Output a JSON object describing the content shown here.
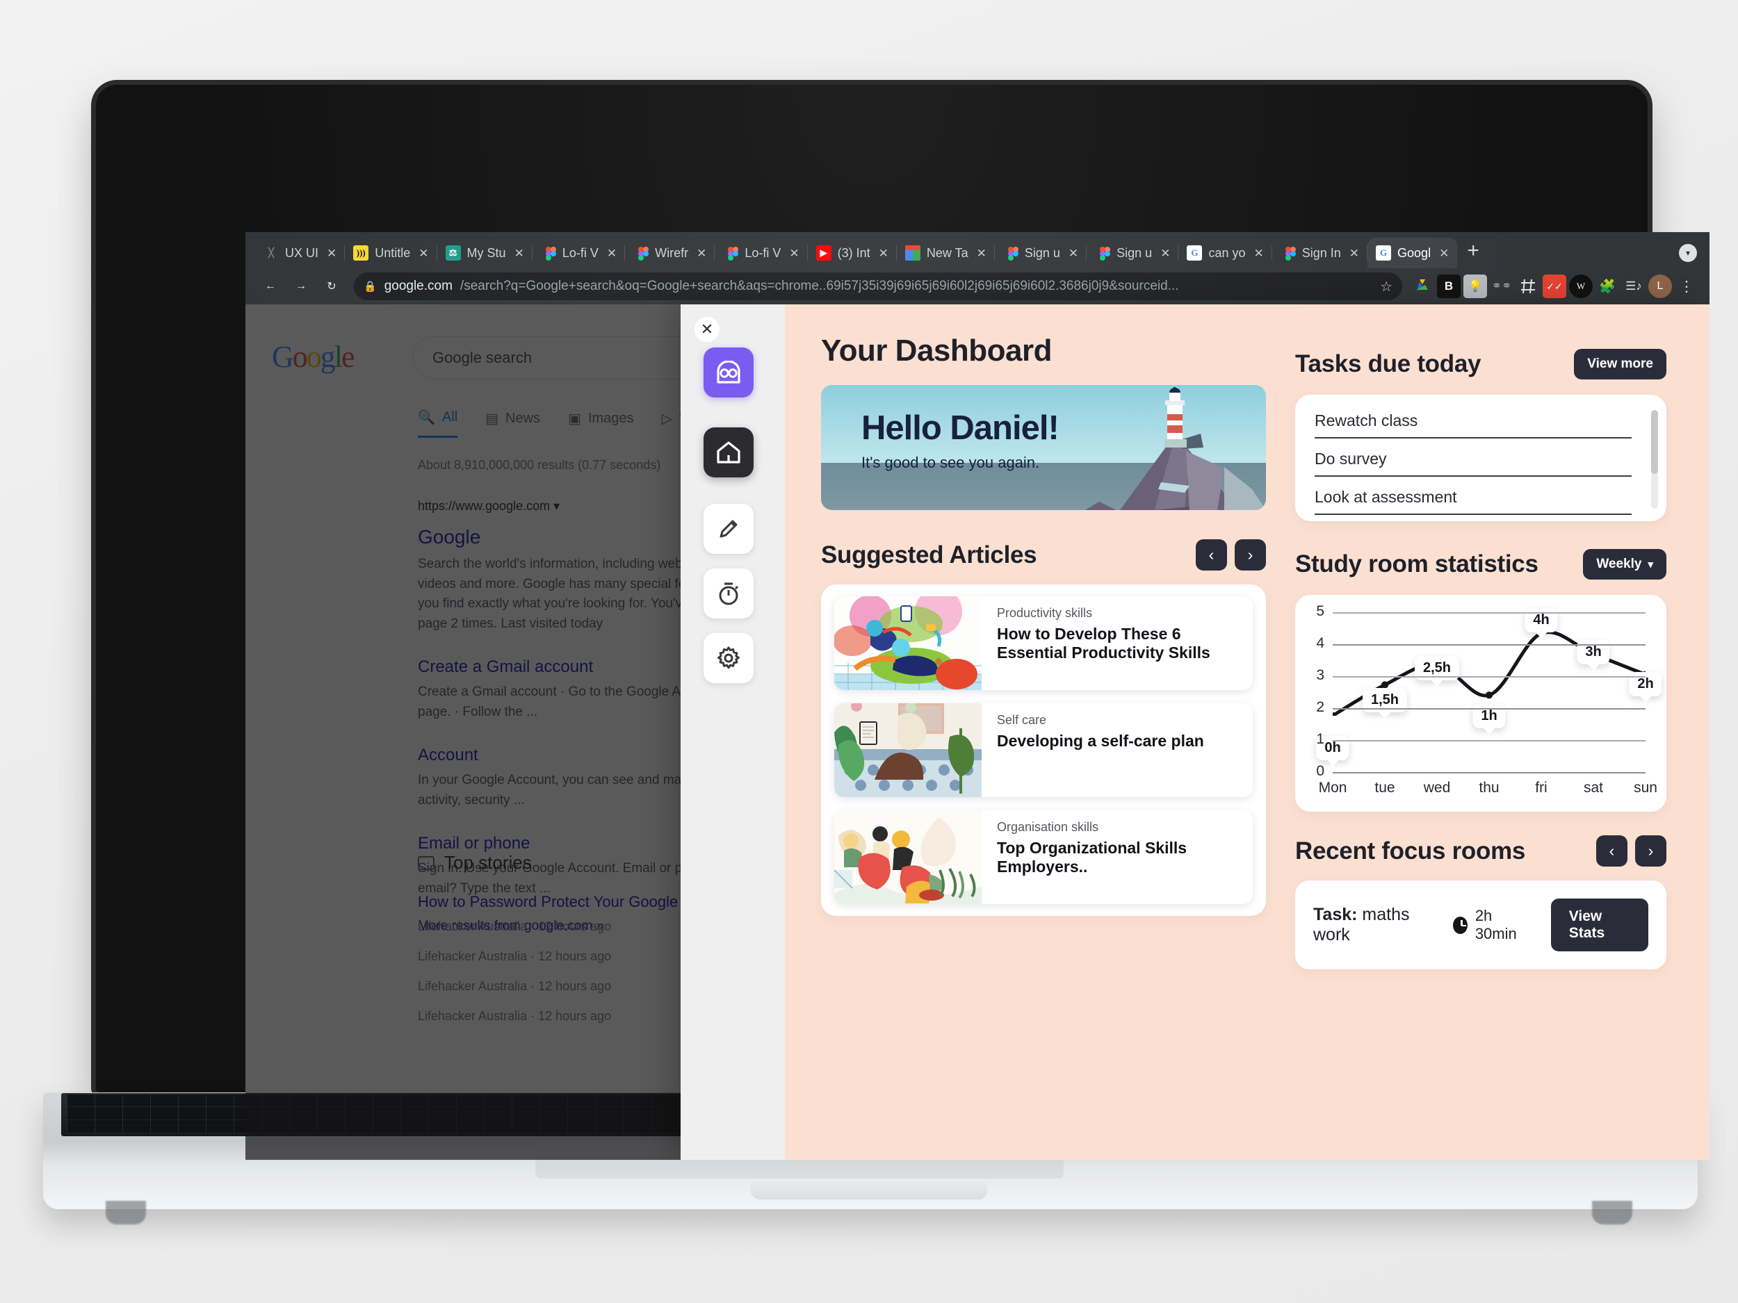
{
  "browser": {
    "tabs": [
      {
        "label": "UX UI",
        "favicon": "generic-icon"
      },
      {
        "label": "Untitle",
        "favicon": "notion-icon"
      },
      {
        "label": "My Stu",
        "favicon": "drive-doc-icon"
      },
      {
        "label": "Lo-fi V",
        "favicon": "figma-icon"
      },
      {
        "label": "Wirefr",
        "favicon": "figma-icon"
      },
      {
        "label": "Lo-fi V",
        "favicon": "figma-icon"
      },
      {
        "label": "(3) Int",
        "favicon": "youtube-icon"
      },
      {
        "label": "New Ta",
        "favicon": "chrome-store-icon"
      },
      {
        "label": "Sign u",
        "favicon": "figma-icon"
      },
      {
        "label": "Sign u",
        "favicon": "figma-icon"
      },
      {
        "label": "can yo",
        "favicon": "google-icon"
      },
      {
        "label": "Sign In",
        "favicon": "figma-icon"
      },
      {
        "label": "Googl",
        "favicon": "google-icon",
        "active": true
      }
    ],
    "close_label": "✕",
    "new_tab_label": "+",
    "tabstrip_menu_icon": "chevron-down-icon",
    "nav": {
      "back_icon": "←",
      "forward_icon": "→",
      "reload_icon": "↻"
    },
    "omnibox": {
      "lock_icon": "🔒",
      "host": "google.com",
      "path": "/search?q=Google+search&oq=Google+search&aqs=chrome..69i57j35i39j69i65j69i60l2j69i65j69i60l2.3686j0j9&sourceid...",
      "star_icon": "☆"
    },
    "extension_icons": [
      "google-drive-icon",
      "bitwarden-icon",
      "lightbulb-icon",
      "glasses-icon",
      "grid-icon",
      "todoist-icon",
      "wm-icon",
      "puzzle-piece-icon",
      "playlist-icon",
      "profile-avatar",
      "kebab-menu-icon"
    ],
    "profile_initial": "L"
  },
  "serp": {
    "logo_letters": [
      "G",
      "o",
      "o",
      "g",
      "l",
      "e"
    ],
    "search_value": "Google search",
    "tabs": [
      {
        "label": "All",
        "icon": "search-icon",
        "active": true
      },
      {
        "label": "News",
        "icon": "news-icon"
      },
      {
        "label": "Images",
        "icon": "image-icon"
      },
      {
        "label": "V",
        "icon": "video-icon"
      }
    ],
    "result_count": "About 8,910,000,000 results (0.77 seconds)",
    "url": "https://www.google.com",
    "main_title": "Google",
    "main_snippet": "Search the world's information, including webpages, images, videos and more. Google has many special features to help you find exactly what you're looking for. You've visited this page 2 times. Last visited today",
    "sub_results": [
      {
        "title": "Create a Gmail account",
        "snippet": "Create a Gmail account · Go to the Google Account creation page. · Follow the ..."
      },
      {
        "title": "Account",
        "snippet": "In your Google Account, you can see and manage your info, activity, security ..."
      },
      {
        "title": "Email or phone",
        "snippet": "Sign in. Use your Google Account. Email or phone. Forgot email? Type the text ..."
      }
    ],
    "more_results": "More results from google.com »",
    "top_stories_label": "Top stories",
    "stories": [
      {
        "title": "How to Password Protect Your Google Secrets",
        "source": "Lifehacker Australia",
        "time": "12 hours ago"
      },
      {
        "source": "Lifehacker Australia",
        "time": "12 hours ago"
      },
      {
        "source": "Lifehacker Australia",
        "time": "12 hours ago"
      },
      {
        "source": "Lifehacker Australia",
        "time": "12 hours ago"
      }
    ]
  },
  "extension": {
    "close_icon": "✕",
    "rail": [
      {
        "name": "logo",
        "icon": "owl-logo-icon",
        "active": false
      },
      {
        "name": "home",
        "icon": "home-icon",
        "active": true
      },
      {
        "name": "notes",
        "icon": "pencil-icon",
        "active": false
      },
      {
        "name": "timer",
        "icon": "stopwatch-icon",
        "active": false
      },
      {
        "name": "settings",
        "icon": "gear-icon",
        "active": false
      }
    ],
    "accent_purple": "#7b5cf0",
    "accent_dark": "#2b2c39",
    "panel_bg": "#fbe0d2",
    "title": "Your Dashboard",
    "hero": {
      "greeting": "Hello Daniel!",
      "subtext": "It's good to see you again."
    },
    "articles": {
      "heading": "Suggested Articles",
      "prev_icon": "‹",
      "next_icon": "›",
      "items": [
        {
          "category": "Productivity skills",
          "title": "How to Develop These 6 Essential Productivity Skills"
        },
        {
          "category": "Self care",
          "title": "Developing a self-care plan"
        },
        {
          "category": "Organisation skills",
          "title": "Top Organizational Skills Employers.."
        }
      ]
    },
    "tasks": {
      "heading": "Tasks due today",
      "view_more_label": "View more",
      "items": [
        "Rewatch class",
        "Do survey",
        "Look at assessment"
      ]
    },
    "stats": {
      "heading": "Study room statistics",
      "range_label": "Weekly",
      "range_chevron": "⌄"
    },
    "focus": {
      "heading": "Recent focus rooms",
      "prev_icon": "‹",
      "next_icon": "›",
      "task_label": "Task:",
      "task_name": "maths work",
      "duration": "2h 30min",
      "clock_icon": "clock-icon",
      "view_stats_label": "View Stats"
    }
  },
  "chart_data": {
    "type": "line",
    "title": "Study room statistics",
    "xlabel": "",
    "ylabel": "",
    "categories": [
      "Mon",
      "tue",
      "wed",
      "thu",
      "fri",
      "sat",
      "sun"
    ],
    "values": [
      0,
      1.5,
      2.5,
      1,
      4,
      3,
      2
    ],
    "point_labels": [
      "0h",
      "1,5h",
      "2,5h",
      "1h",
      "4h",
      "3h",
      "2h"
    ],
    "yticks": [
      0,
      1,
      2,
      3,
      4,
      5
    ],
    "ytick_labels": [
      "0",
      "1",
      "2",
      "3",
      "4",
      "5"
    ],
    "ylim": [
      0,
      5
    ],
    "grid": true,
    "legend": "none",
    "line_color": "#15161b",
    "marker_color": "#15161b",
    "smooth": true
  }
}
